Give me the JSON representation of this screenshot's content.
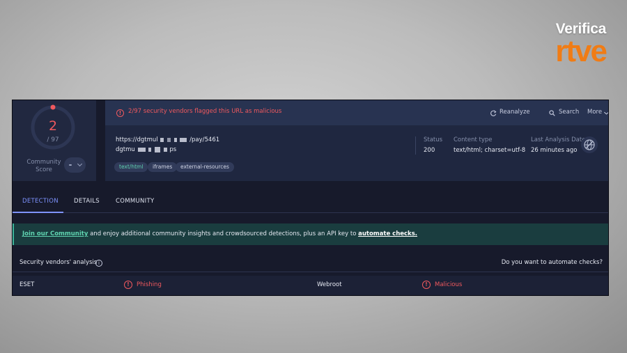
{
  "logo": {
    "top": "Verifica",
    "bottom": "rtve"
  },
  "score": {
    "value": "2",
    "total": "/ 97",
    "community_label": "Community Score"
  },
  "alert": {
    "text": "2/97 security vendors flagged this URL as malicious"
  },
  "actions": {
    "reanalyze": "Reanalyze",
    "search": "Search",
    "more": "More"
  },
  "url": {
    "full": "https://dgtmul",
    "path": "/pay/5461",
    "host_start": "dgtmu",
    "host_end": "ps"
  },
  "tags": [
    "text/html",
    "iframes",
    "external-resources"
  ],
  "meta": {
    "status_label": "Status",
    "status_value": "200",
    "content_label": "Content type",
    "content_value": "text/html; charset=utf-8",
    "analysis_label": "Last Analysis Date",
    "analysis_value": "26 minutes ago"
  },
  "tabs": [
    "DETECTION",
    "DETAILS",
    "COMMUNITY"
  ],
  "banner": {
    "link": "Join our Community",
    "text": " and enjoy additional community insights and crowdsourced detections, plus an API key to ",
    "link2": "automate checks."
  },
  "vendors": {
    "title": "Security vendors' analysis",
    "automate_question": "Do you want to automate checks?",
    "rows": [
      {
        "vendor1": "ESET",
        "result1": "Phishing",
        "vendor2": "Webroot",
        "result2": "Malicious"
      }
    ]
  },
  "colors": {
    "malicious": "#f0595e",
    "accent": "#7e93ff",
    "brand": "#f07c15",
    "success": "#5fd3b0"
  }
}
